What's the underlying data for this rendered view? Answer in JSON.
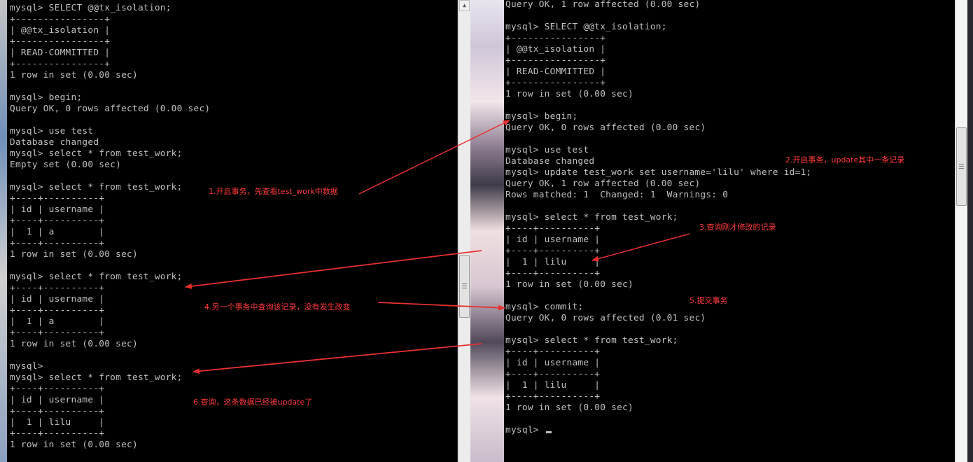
{
  "left_terminal": {
    "text": "mysql> SELECT @@tx_isolation;\n+----------------+\n| @@tx_isolation |\n+----------------+\n| READ-COMMITTED |\n+----------------+\n1 row in set (0.00 sec)\n\nmysql> begin;\nQuery OK, 0 rows affected (0.00 sec)\n\nmysql> use test\nDatabase changed\nmysql> select * from test_work;\nEmpty set (0.00 sec)\n\nmysql> select * from test_work;\n+----+----------+\n| id | username |\n+----+----------+\n|  1 | a        |\n+----+----------+\n1 row in set (0.00 sec)\n\nmysql> select * from test_work;\n+----+----------+\n| id | username |\n+----+----------+\n|  1 | a        |\n+----+----------+\n1 row in set (0.00 sec)\n\nmysql>\nmysql> select * from test_work;\n+----+----------+\n| id | username |\n+----+----------+\n|  1 | lilu     |\n+----+----------+\n1 row in set (0.00 sec)"
  },
  "right_terminal": {
    "text": "Query OK, 1 row affected (0.00 sec)\n\nmysql> SELECT @@tx_isolation;\n+----------------+\n| @@tx_isolation |\n+----------------+\n| READ-COMMITTED |\n+----------------+\n1 row in set (0.00 sec)\n\nmysql> begin;\nQuery OK, 0 rows affected (0.00 sec)\n\nmysql> use test\nDatabase changed\nmysql> update test_work set username='lilu' where id=1;\nQuery OK, 1 row affected (0.00 sec)\nRows matched: 1  Changed: 1  Warnings: 0\n\nmysql> select * from test_work;\n+----+----------+\n| id | username |\n+----+----------+\n|  1 | lilu     |\n+----+----------+\n1 row in set (0.00 sec)\n\nmysql> commit;\nQuery OK, 0 rows affected (0.01 sec)\n\nmysql> select * from test_work;\n+----+----------+\n| id | username |\n+----+----------+\n|  1 | lilu     |\n+----+----------+\n1 row in set (0.00 sec)\n\nmysql> "
  },
  "annotations": {
    "step1": "1.开启事务，先查看test_work中数据",
    "step2": "2.开启事务，update其中一条记录",
    "step3": "3.查询刚才修改的记录",
    "step4": "4.另一个事务中查询该记录，没有发生改变",
    "step5": "5.提交事务",
    "step6": "6.查询，这条数据已经被update了"
  },
  "colors": {
    "terminal_bg": "#000000",
    "terminal_text": "#c0c0c0",
    "annotation": "#ff3b3b",
    "arrow": "#e83030"
  },
  "icons": {
    "scroll_up": "up-arrow-icon",
    "scroll_down": "down-arrow-icon",
    "thumb_grip": "grip-icon"
  }
}
